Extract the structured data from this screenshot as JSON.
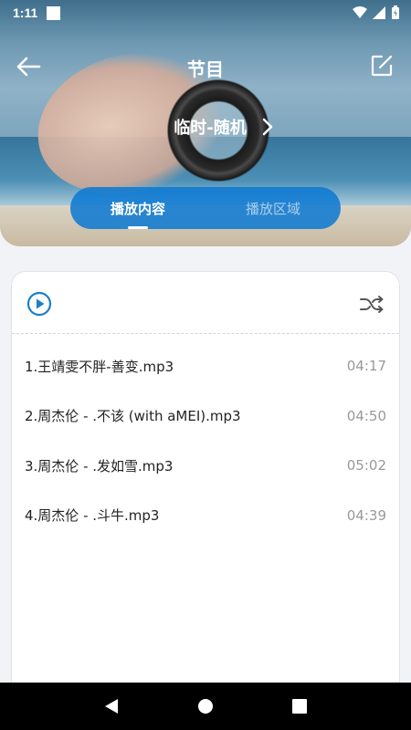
{
  "status_bar": {
    "time": "1:11"
  },
  "toolbar": {
    "title": "节目"
  },
  "mode": {
    "label": "临时-随机"
  },
  "tabs": [
    {
      "label": "播放内容",
      "active": true
    },
    {
      "label": "播放区域",
      "active": false
    }
  ],
  "tracks": [
    {
      "name": "1.王靖雯不胖-善变.mp3",
      "duration": "04:17"
    },
    {
      "name": "2.周杰伦 - .不该 (with aMEI).mp3",
      "duration": "04:50"
    },
    {
      "name": "3.周杰伦 - .发如雪.mp3",
      "duration": "05:02"
    },
    {
      "name": "4.周杰伦 - .斗牛.mp3",
      "duration": "04:39"
    }
  ],
  "icons": {
    "back": "arrow-left-icon",
    "edit": "edit-icon",
    "chevron": "chevron-right-icon",
    "play": "play-circle-icon",
    "shuffle": "shuffle-icon",
    "nav_back": "triangle-back-icon",
    "nav_home": "circle-home-icon",
    "nav_recents": "square-recents-icon"
  },
  "colors": {
    "accent": "#0a78d2",
    "play_icon": "#1a7fc6",
    "text_primary": "#222222",
    "text_secondary": "#999999"
  }
}
